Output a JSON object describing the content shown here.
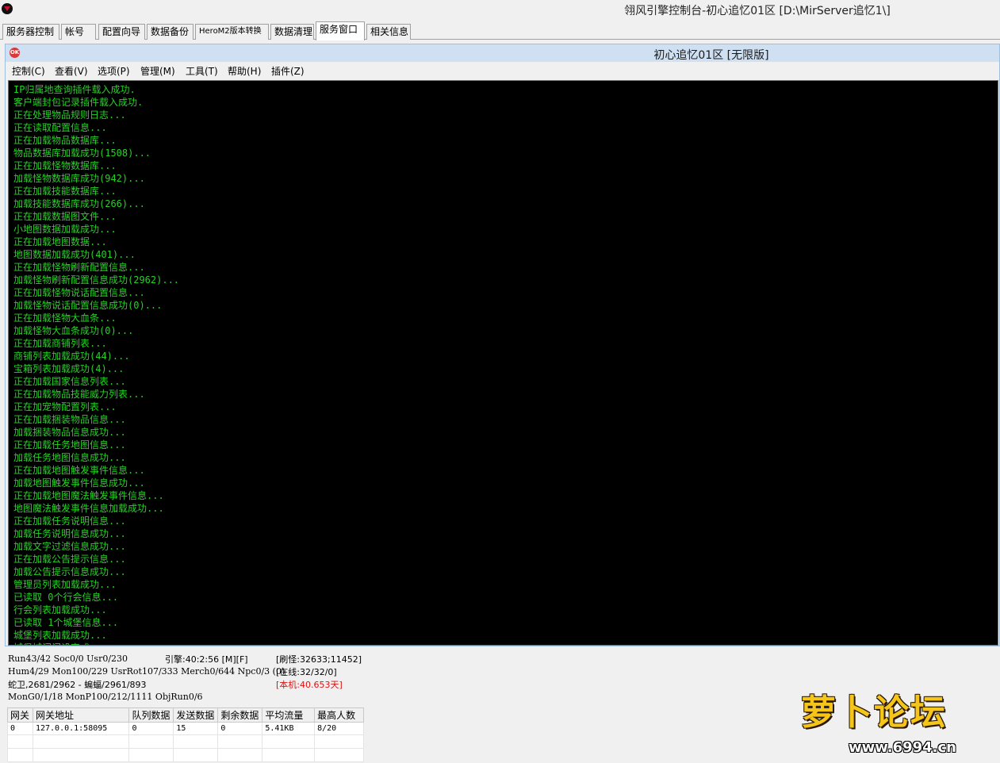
{
  "window": {
    "title": "翎风引擎控制台-初心追忆01区 [D:\\MirServer追忆1\\]"
  },
  "tabs": [
    {
      "label": "服务器控制"
    },
    {
      "label": "帐号"
    },
    {
      "label": "配置向导"
    },
    {
      "label": "数据备份"
    },
    {
      "label": "HeroM2版本转换"
    },
    {
      "label": "数据清理"
    },
    {
      "label": "服务窗口",
      "active": true
    },
    {
      "label": "相关信息"
    }
  ],
  "inner_window": {
    "icon_text": "OK",
    "title": "初心追忆01区 [无限版]",
    "menu": [
      "控制(C)",
      "查看(V)",
      "选项(P)",
      "管理(M)",
      "工具(T)",
      "帮助(H)",
      "插件(Z)"
    ]
  },
  "log_lines": [
    "IP归属地查询插件载入成功.",
    "客户端封包记录插件载入成功.",
    "正在处理物品规则日志...",
    "正在读取配置信息...",
    "正在加载物品数据库...",
    "物品数据库加载成功(1508)...",
    "正在加载怪物数据库...",
    "加载怪物数据库成功(942)...",
    "正在加载技能数据库...",
    "加载技能数据库成功(266)...",
    "正在加载数据图文件...",
    "小地图数据加载成功...",
    "正在加载地图数据...",
    "地图数据加载成功(401)...",
    "正在加载怪物刷新配置信息...",
    "加载怪物刷新配置信息成功(2962)...",
    "正在加载怪物说话配置信息...",
    "加载怪物说话配置信息成功(0)...",
    "正在加载怪物大血条...",
    "加载怪物大血条成功(0)...",
    "正在加载商铺列表...",
    "商铺列表加载成功(44)...",
    "宝箱列表加载成功(4)...",
    "正在加载国家信息列表...",
    "正在加载物品技能威力列表...",
    "正在加宠物配置列表...",
    "正在加载捆装物品信息...",
    "加载捆装物品信息成功...",
    "正在加载任务地图信息...",
    "加载任务地图信息成功...",
    "正在加载地图触发事件信息...",
    "加载地图触发事件信息成功...",
    "正在加载地图魔法触发事件信息...",
    "地图魔法触发事件信息加载成功...",
    "正在加载任务说明信息...",
    "加载任务说明信息成功...",
    "加载文字过滤信息成功...",
    "正在加载公告提示信息...",
    "加载公告提示信息成功...",
    "管理员列表加载成功...",
    "已读取 0个行会信息...",
    "行会列表加载成功...",
    "已读取 1个城堡信息...",
    "城堡列表加载成功...",
    "城堡城门门设完成..."
  ],
  "status": {
    "run": "Run43/42 Soc0/0 Usr0/230",
    "engine": "引擎:40:2:56 [M][F]",
    "refresh": "[刷怪:32633;11452]",
    "hum": "Hum4/29 Mon100/229 UsrRot107/333 Merch0/644 Npc0/3 (0)",
    "online": "[在线:32/32/0]",
    "boss": "蛇卫,2681/2962 - 蝙蝠/2961/893",
    "local": "[本机:40.653天]",
    "mon": "MonG0/1/18 MonP100/212/1111 ObjRun0/6"
  },
  "gateway_table": {
    "headers": [
      "网关",
      "网关地址",
      "队列数据",
      "发送数据",
      "剩余数据",
      "平均流量",
      "最高人数"
    ],
    "rows": [
      [
        "0",
        "127.0.0.1:58095",
        "0",
        "15",
        "0",
        "5.41KB",
        "8/20"
      ]
    ]
  },
  "watermark": {
    "logo": "萝卜论坛",
    "url": "www.6994.cn"
  }
}
